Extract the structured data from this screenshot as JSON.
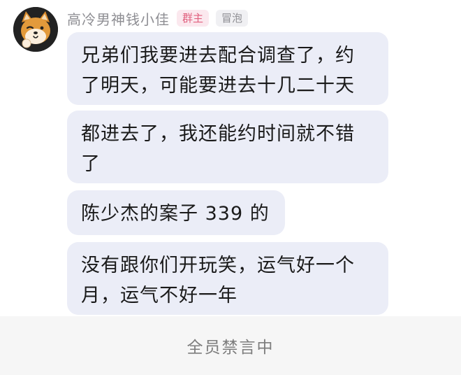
{
  "group_chat": {
    "sender": {
      "name": "高冷男神钱小佳",
      "badges": [
        "群主",
        "冒泡"
      ],
      "avatar_icon": "shiba-dog-avatar-icon"
    },
    "messages": [
      {
        "text": "兄弟们我要进去配合调查了，约\n了明天，可能要进去十几二十天"
      },
      {
        "text": "都进去了，我还能约时间就不错\n了"
      },
      {
        "text": "陈少杰的案子 339 的"
      },
      {
        "text": "没有跟你们开玩笑，运气好一个\n月，运气不好一年"
      }
    ],
    "footer": {
      "status_text": "全员禁言中"
    },
    "colors": {
      "bubble_bg": "#ebedf7",
      "owner_badge": "#e0607e",
      "footer_bg": "#f6f6f6"
    }
  }
}
